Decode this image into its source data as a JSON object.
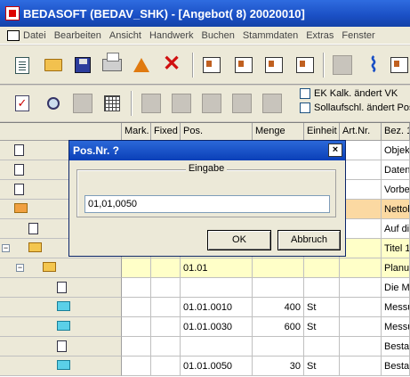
{
  "window": {
    "title": "BEDASOFT (BEDAV_SHK) - [Angebot( 8) 20020010]"
  },
  "menu": [
    "Datei",
    "Bearbeiten",
    "Ansicht",
    "Handwerk",
    "Buchen",
    "Stammdaten",
    "Extras",
    "Fenster"
  ],
  "options": {
    "ek_label": "EK Kalk. ändert VK",
    "soll_label": "Sollaufschl. ändert Pos."
  },
  "columns": [
    "Mark.",
    "Fixed",
    "Pos.",
    "Menge",
    "Einheit",
    "Art.Nr.",
    "Bez. 1"
  ],
  "rows": [
    {
      "pos": "",
      "menge": "",
      "einheit": "",
      "artnr": "",
      "bez": "Objekt"
    },
    {
      "pos": "",
      "menge": "",
      "einheit": "",
      "artnr": "",
      "bez": "Daten"
    },
    {
      "pos": "",
      "menge": "",
      "einheit": "",
      "artnr": "",
      "bez": "Vorber"
    },
    {
      "pos": "",
      "menge": "",
      "einheit": "",
      "artnr": "",
      "bez": "Nettob"
    },
    {
      "pos": "",
      "menge": "",
      "einheit": "",
      "artnr": "",
      "bez": "Auf die"
    },
    {
      "pos": "",
      "menge": "",
      "einheit": "",
      "artnr": "",
      "bez": "Titel 1"
    },
    {
      "pos": "01.01",
      "menge": "",
      "einheit": "",
      "artnr": "",
      "bez": "Planun"
    },
    {
      "pos": "",
      "menge": "",
      "einheit": "",
      "artnr": "",
      "bez": "Die Me"
    },
    {
      "pos": "01.01.0010",
      "menge": "400",
      "einheit": "St",
      "artnr": "",
      "bez": "Messu"
    },
    {
      "pos": "01.01.0030",
      "menge": "600",
      "einheit": "St",
      "artnr": "",
      "bez": "Messu"
    },
    {
      "pos": "",
      "menge": "",
      "einheit": "",
      "artnr": "",
      "bez": "Bestan"
    },
    {
      "pos": "01.01.0050",
      "menge": "30",
      "einheit": "St",
      "artnr": "",
      "bez": "Bestan"
    }
  ],
  "dialog": {
    "title": "Pos.Nr. ?",
    "close_glyph": "×",
    "group_label": "Eingabe",
    "input_value": "01,01,0050",
    "ok_label": "OK",
    "cancel_label": "Abbruch"
  },
  "glyphs": {
    "minus": "−",
    "check": "✓",
    "x": "✕",
    "clip": "⌇"
  }
}
